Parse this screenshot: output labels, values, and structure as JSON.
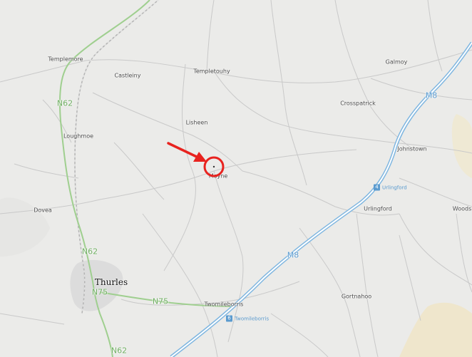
{
  "map": {
    "colors": {
      "background": "#ebebe9",
      "minor_road": "#c8c8c8",
      "national_road": "#a8d39a",
      "motorway": "#7fb6e0",
      "railway": "#b3b3b3",
      "urban": "#dcdcdc",
      "terrain": "#efe9d4",
      "marker": "#e8231f"
    },
    "places": [
      {
        "id": "templemore",
        "label": "Templemore"
      },
      {
        "id": "castleiny",
        "label": "Castleiny"
      },
      {
        "id": "templetouhy",
        "label": "Templetouhy"
      },
      {
        "id": "galmoy",
        "label": "Galmoy"
      },
      {
        "id": "crosspatrick",
        "label": "Crosspatrick"
      },
      {
        "id": "lisheen",
        "label": "Lisheen"
      },
      {
        "id": "loughmoe",
        "label": "Loughmoe"
      },
      {
        "id": "johnstown",
        "label": "Johnstown"
      },
      {
        "id": "moyne",
        "label": "Moyne"
      },
      {
        "id": "dovea",
        "label": "Dovea"
      },
      {
        "id": "urlingford",
        "label": "Urlingford"
      },
      {
        "id": "woods",
        "label": "Woods"
      },
      {
        "id": "gortnahoo",
        "label": "Gortnahoo"
      },
      {
        "id": "twomileborris",
        "label": "Twomileborris"
      },
      {
        "id": "thurles",
        "label": "Thurles",
        "major": true
      }
    ],
    "road_labels": [
      {
        "id": "n62-north",
        "label": "N62",
        "class": "national"
      },
      {
        "id": "n62-middle",
        "label": "N62",
        "class": "national"
      },
      {
        "id": "n62-south",
        "label": "N62",
        "class": "national"
      },
      {
        "id": "n75-thurles",
        "label": "N75",
        "class": "national"
      },
      {
        "id": "n75-east",
        "label": "N75",
        "class": "national"
      },
      {
        "id": "m8-north",
        "label": "M8",
        "class": "motorway"
      },
      {
        "id": "m8-south",
        "label": "M8",
        "class": "motorway"
      }
    ],
    "junctions": [
      {
        "id": "junction-urlingford",
        "number": "4",
        "label": "Urlingford"
      },
      {
        "id": "junction-twomileborris",
        "number": "6",
        "label": "Twomileborris"
      }
    ],
    "marker": {
      "type": "circle-with-arrow",
      "icon": "location-pin"
    }
  }
}
